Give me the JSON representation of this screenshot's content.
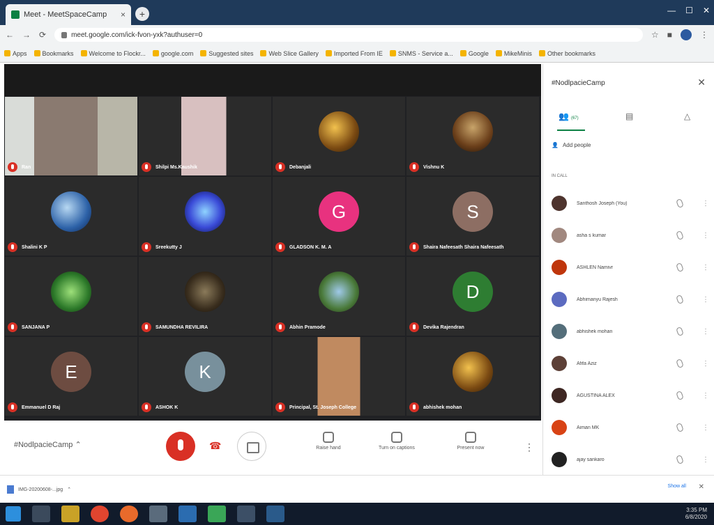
{
  "browser": {
    "tab_title": "Meet - MeetSpaceCamp",
    "new_tab": "+",
    "url": "meet.google.com/ick-fvon-yxk?authuser=0",
    "bookmarks": [
      "Apps",
      "Bookmarks",
      "Welcome to Flockr...",
      "google.com",
      "Suggested sites",
      "Web Slice Gallery",
      "Imported From IE",
      "SNMS - Service a...",
      "Google",
      "MikeMinis",
      "Other bookmarks"
    ]
  },
  "meeting": {
    "title": "#NodlpacieCamp",
    "participants_grid": [
      {
        "name": "Ran",
        "type": "video"
      },
      {
        "name": "Shilpi Ms.Kaushik",
        "type": "video"
      },
      {
        "name": "Debanjali",
        "type": "photo"
      },
      {
        "name": "Vishnu K",
        "type": "photo"
      },
      {
        "name": "Shalini K P",
        "type": "photo"
      },
      {
        "name": "Sreekutty J",
        "type": "photo"
      },
      {
        "name": "GLADSON K. M. A",
        "type": "letter",
        "letter": "G",
        "color": "#e8327f"
      },
      {
        "name": "Shaira Nafeesath Shaira Nafeesath",
        "type": "letter",
        "letter": "S",
        "color": "#8d6e63"
      },
      {
        "name": "SANJANA P",
        "type": "photo"
      },
      {
        "name": "SAMUNDHA REVILIRA",
        "type": "photo"
      },
      {
        "name": "Abhin Pramode",
        "type": "photo"
      },
      {
        "name": "Devika Rajendran",
        "type": "letter",
        "letter": "D",
        "color": "#2e7d32"
      },
      {
        "name": "Emmanuel D Raj",
        "type": "letter",
        "letter": "E",
        "color": "#6d4c41"
      },
      {
        "name": "ASHOK K",
        "type": "letter",
        "letter": "K",
        "color": "#78909c"
      },
      {
        "name": "Principal, St. Joseph College",
        "type": "video"
      },
      {
        "name": "abhishek mohan",
        "type": "photo"
      }
    ],
    "actions": {
      "raise_hand": "Raise hand",
      "captions": "Turn on captions",
      "present": "Present now"
    }
  },
  "panel": {
    "title": "#NodlpacieCamp",
    "people_count": "(67)",
    "add_people": "Add people",
    "section": "IN CALL",
    "people": [
      {
        "name": "Santhosh Joseph (You)",
        "color": "#4e342e"
      },
      {
        "name": "asha s kumar",
        "color": "#a1887f"
      },
      {
        "name": "ASHLEN Namivr",
        "color": "#bf360c"
      },
      {
        "name": "Abhimanyu Rajesh",
        "color": "#5c6bc0"
      },
      {
        "name": "abhishek mohan",
        "color": "#546e7a"
      },
      {
        "name": "Afifa Aziz",
        "color": "#5d4037"
      },
      {
        "name": "AGUSTINA ALEX",
        "color": "#3e2723"
      },
      {
        "name": "Aiman MK",
        "color": "#d84315"
      },
      {
        "name": "ajay sankaro",
        "color": "#212121"
      }
    ]
  },
  "downloads": {
    "file": "IMG-20200608-...jpg",
    "show_all": "Show all"
  },
  "taskbar": {
    "time": "3:35 PM",
    "date": "6/8/2020"
  }
}
